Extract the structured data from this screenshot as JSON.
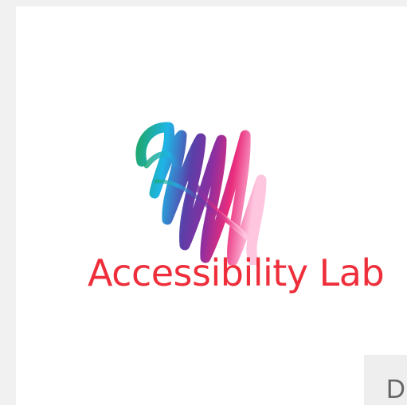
{
  "brand": {
    "title": "Accessibility Lab",
    "title_color": "#ee2e3a",
    "mark_icon": "scribble-heart-icon",
    "gradient_colors": [
      "#1fa873",
      "#1fb5e6",
      "#5a3fa8",
      "#8a2fa0",
      "#e92c7c",
      "#ffb8d8"
    ]
  },
  "corner_button": {
    "label": "D"
  },
  "colors": {
    "page_background": "#f1f1f1",
    "card_background": "#ffffff",
    "button_background": "#eeeeee",
    "button_text": "#666666"
  }
}
